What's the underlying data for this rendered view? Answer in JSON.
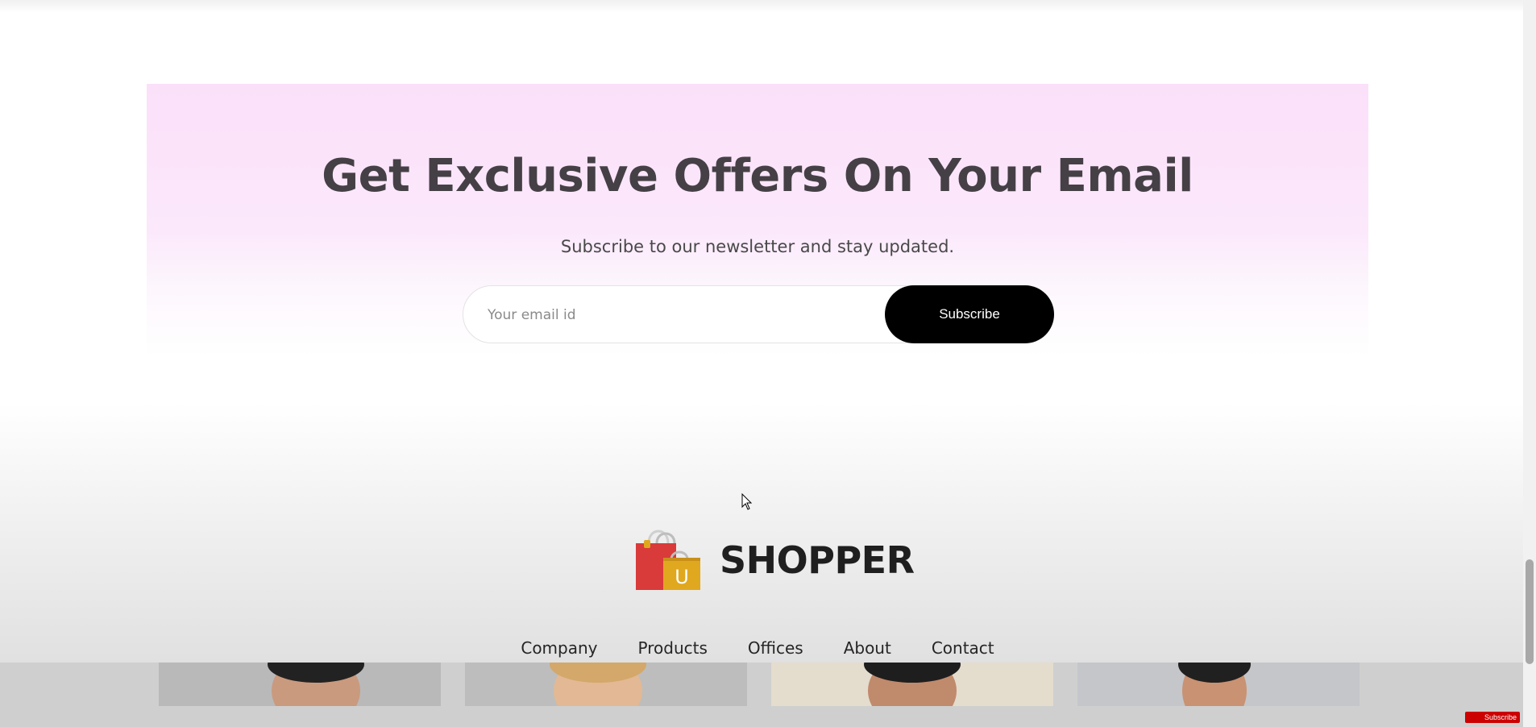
{
  "newsletter": {
    "title": "Get Exclusive Offers On Your Email",
    "subtitle": "Subscribe to our newsletter and stay updated.",
    "email_placeholder": "Your email id",
    "email_value": "",
    "button_label": "Subscribe"
  },
  "footer": {
    "brand_name": "SHOPPER",
    "logo_letter": "U",
    "links": [
      "Company",
      "Products",
      "Offices",
      "About",
      "Contact"
    ]
  },
  "overlay": {
    "badge_label": "Subscribe"
  },
  "colors": {
    "newsletter_bg_top": "#fbe0fa",
    "button_bg": "#000000",
    "title_text": "#454045",
    "bag_red": "#d93a3a",
    "bag_gold": "#e0a81f"
  },
  "icons": {
    "logo": "shopping-bag-icon",
    "cursor": "mouse-pointer-icon"
  }
}
